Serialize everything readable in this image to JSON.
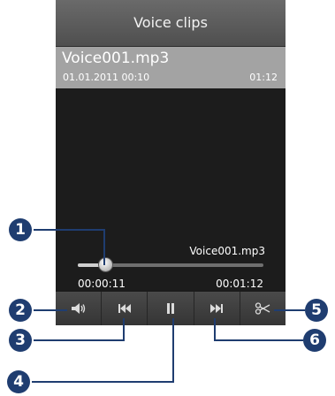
{
  "header": {
    "title": "Voice clips"
  },
  "file": {
    "name": "Voice001.mp3",
    "date": "01.01.2011 00:10",
    "duration": "01:12"
  },
  "player": {
    "track_name": "Voice001.mp3",
    "elapsed": "00:00:11",
    "total": "00:01:12",
    "progress_fraction": 0.15
  },
  "controls": [
    {
      "icon": "volume-icon"
    },
    {
      "icon": "rewind-icon"
    },
    {
      "icon": "pause-icon"
    },
    {
      "icon": "fast-forward-icon"
    },
    {
      "icon": "scissors-icon"
    }
  ],
  "callouts": [
    "1",
    "2",
    "3",
    "4",
    "5",
    "6"
  ],
  "colors": {
    "callout": "#1f3d70",
    "file_bar": "#a3a3a3"
  }
}
